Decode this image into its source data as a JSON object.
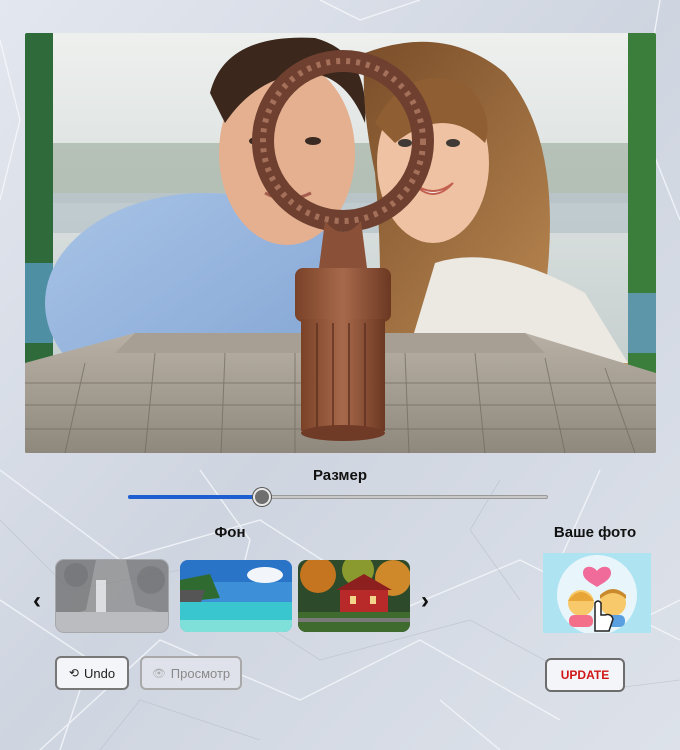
{
  "size_label": "Размер",
  "slider": {
    "value_fraction": 0.32
  },
  "backgrounds": {
    "label": "Фон",
    "prev_arrow": "‹",
    "next_arrow": "›",
    "items": [
      {
        "name": "waterfall",
        "selected": true
      },
      {
        "name": "tropical-beach",
        "selected": false
      },
      {
        "name": "autumn-cottage",
        "selected": false
      }
    ]
  },
  "your_photo": {
    "label": "Ваше фото"
  },
  "buttons": {
    "undo_icon": "⟲",
    "undo": "Undo",
    "preview_icon": "👁",
    "preview": "Просмотр",
    "update": "UPDATE"
  },
  "colors": {
    "accent": "#1d5fd1",
    "update_text": "#d01616"
  }
}
